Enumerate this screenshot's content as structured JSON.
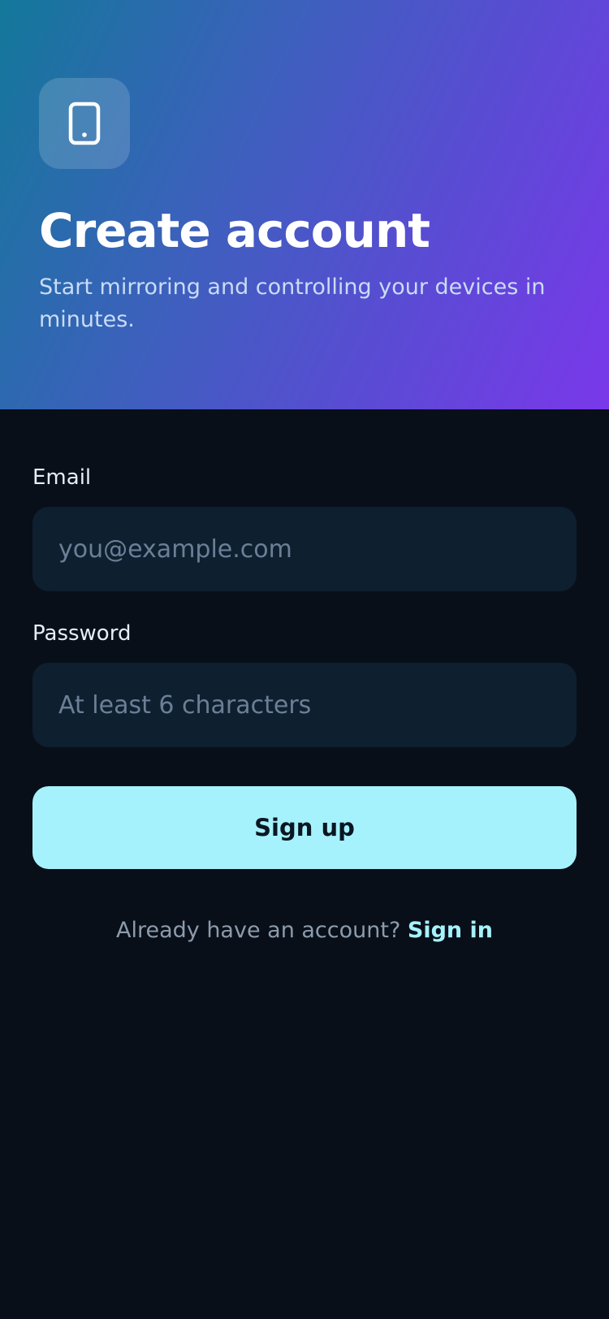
{
  "header": {
    "app_icon": "smartphone-icon",
    "title": "Create account",
    "subtitle": "Start mirroring and controlling your devices in minutes.",
    "gradient_colors": [
      "#13789a",
      "#5c4ad5",
      "#7a38ea"
    ]
  },
  "form": {
    "email_label": "Email",
    "email_placeholder": "you@example.com",
    "email_value": "",
    "password_label": "Password",
    "password_placeholder": "At least 6 characters",
    "password_value": "",
    "submit_label": "Sign up"
  },
  "footer": {
    "prompt": "Already have an account?",
    "link_label": "Sign in"
  },
  "colors": {
    "background": "#080f19",
    "field_background": "#0e1f2f",
    "accent": "#a6f2fc"
  }
}
